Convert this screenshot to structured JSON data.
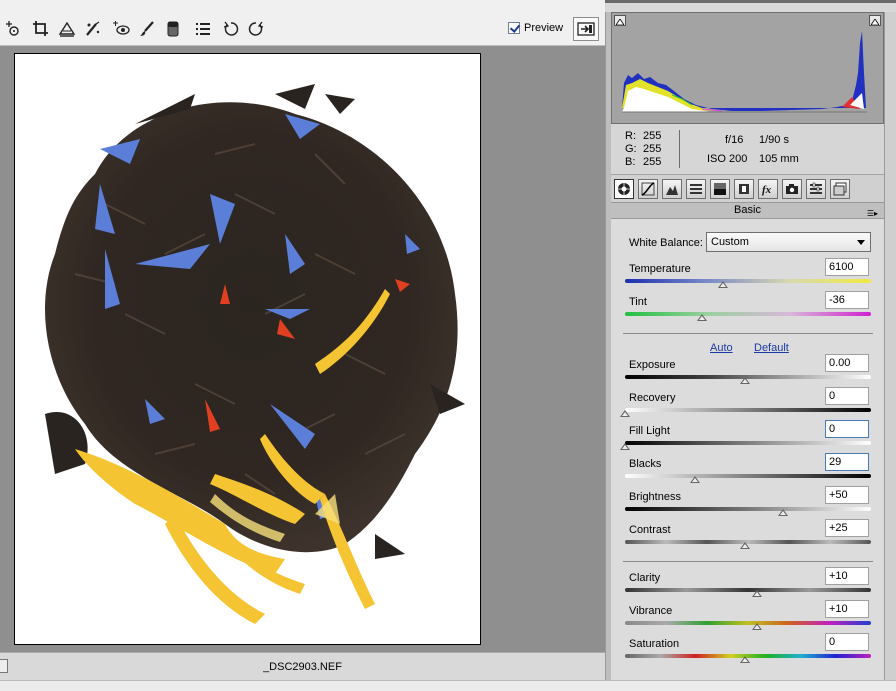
{
  "toolbar": {
    "tools": [
      {
        "icon": "color-sampler-icon"
      },
      {
        "icon": "crop-icon"
      },
      {
        "icon": "straighten-icon"
      },
      {
        "icon": "spot-removal-icon"
      },
      {
        "icon": "red-eye-icon"
      },
      {
        "icon": "adjustment-brush-icon"
      },
      {
        "icon": "graduated-filter-icon"
      },
      {
        "icon": "preferences-list-icon"
      },
      {
        "icon": "rotate-ccw-icon"
      },
      {
        "icon": "rotate-cw-icon"
      }
    ],
    "preview_label": "Preview",
    "preview_checked": true,
    "fullscreen_icon": "fullscreen-toggle-icon"
  },
  "status": {
    "filename": "_DSC2903.NEF"
  },
  "info": {
    "r_label": "R:",
    "r_value": "255",
    "g_label": "G:",
    "g_value": "255",
    "b_label": "B:",
    "b_value": "255",
    "aperture": "f/16",
    "shutter": "1/90 s",
    "iso": "ISO 200",
    "focal": "105 mm"
  },
  "panel": {
    "tabs": [
      "basic-tab-icon",
      "tone-curve-tab-icon",
      "detail-tab-icon",
      "hsl-tab-icon",
      "split-toning-tab-icon",
      "lens-corrections-tab-icon",
      "effects-tab-icon",
      "camera-calibration-tab-icon",
      "presets-tab-icon",
      "snapshots-tab-icon"
    ],
    "section_title": "Basic",
    "white_balance_label": "White Balance:",
    "white_balance_value": "Custom",
    "auto_label": "Auto",
    "default_label": "Default",
    "sliders": {
      "temperature": {
        "label": "Temperature",
        "value": "6100",
        "level": 0.41
      },
      "tint": {
        "label": "Tint",
        "value": "-36",
        "level": 0.32
      },
      "exposure": {
        "label": "Exposure",
        "value": "0.00",
        "level": 0.5
      },
      "recovery": {
        "label": "Recovery",
        "value": "0",
        "level": 0.0
      },
      "fill_light": {
        "label": "Fill Light",
        "value": "0",
        "level": 0.0
      },
      "blacks": {
        "label": "Blacks",
        "value": "29",
        "level": 0.29
      },
      "brightness": {
        "label": "Brightness",
        "value": "+50",
        "level": 0.66
      },
      "contrast": {
        "label": "Contrast",
        "value": "+25",
        "level": 0.5
      },
      "clarity": {
        "label": "Clarity",
        "value": "+10",
        "level": 0.55
      },
      "vibrance": {
        "label": "Vibrance",
        "value": "+10",
        "level": 0.55
      },
      "saturation": {
        "label": "Saturation",
        "value": "0",
        "level": 0.5
      }
    }
  },
  "colors": {
    "canvas_bg": "#8f8f8f",
    "link": "#1a3aa8",
    "histogram_bg": "#a3a3a3"
  }
}
